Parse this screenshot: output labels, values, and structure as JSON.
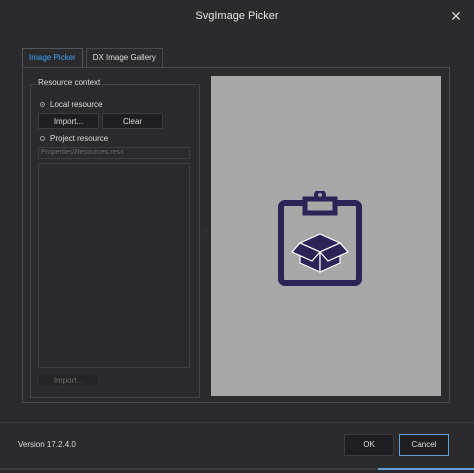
{
  "window": {
    "title": "SvgImage Picker",
    "close_glyph": "✕"
  },
  "tabs": [
    {
      "label": "Image Picker",
      "active": true
    },
    {
      "label": "DX Image Gallery",
      "active": false
    }
  ],
  "resource_context": {
    "group_label": "Resource context",
    "local_resource_label": "Local resource",
    "local_selected": true,
    "import_label": "Import...",
    "clear_label": "Clear",
    "project_resource_label": "Project resource",
    "project_selected": false,
    "resource_path": "Properties\\Resources.resx",
    "project_import_label": "Import..."
  },
  "preview": {
    "icon": "clipboard-box-icon",
    "icon_color": "#2e2356",
    "background": "#a7a7a7"
  },
  "footer": {
    "version": "Version 17.2.4.0",
    "ok_label": "OK",
    "cancel_label": "Cancel"
  },
  "colors": {
    "accent": "#3b9ff5",
    "background": "#2b2b2e"
  }
}
